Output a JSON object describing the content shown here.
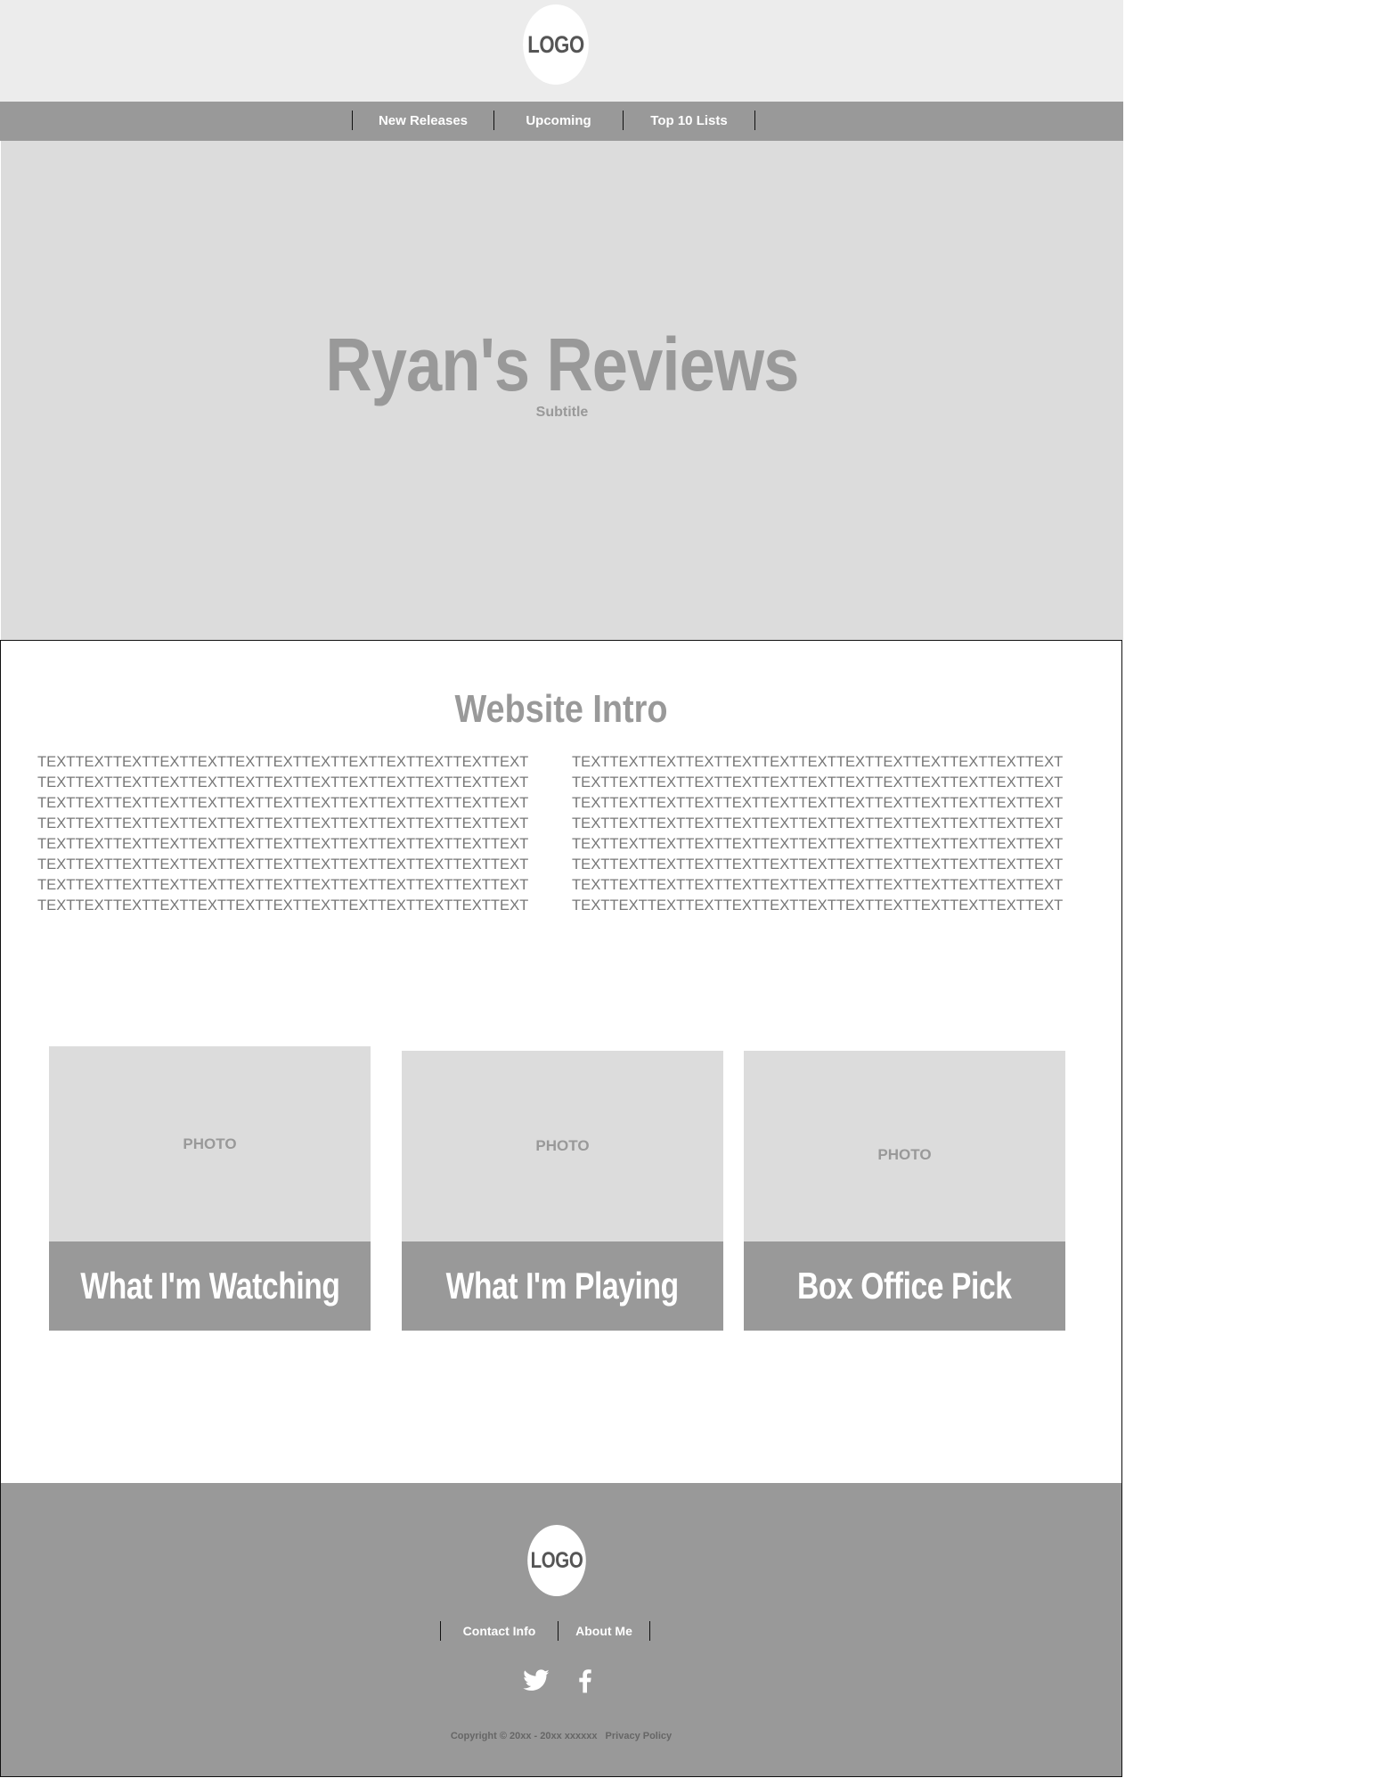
{
  "header": {
    "logo_text": "LOGO"
  },
  "nav": {
    "items": [
      {
        "label": "New Releases"
      },
      {
        "label": "Upcoming"
      },
      {
        "label": "Top 10 Lists"
      }
    ]
  },
  "hero": {
    "title": "Ryan's Reviews",
    "subtitle": "Subtitle"
  },
  "intro": {
    "title": "Website Intro",
    "columns": [
      {
        "text": "TEXTTEXTTEXTTEXTTEXTTEXTTEXTTEXTTEXTTEXTTEXTTEXTTEXTTEXTTEXTTEXTTEXTTEXTTEXTTEXTTEXTTEXTTEXTTEXTTEXTTEXTTEXTTEXTTEXTTEXTTEXTTEXTTEXTTEXTTEXTTEXTTEXTTEXTTEXTTEXTTEXTTEXTTEXTTEXTTEXTTEXTTEXTTEXTTEXTTEXTTEXTTEXTTEXTTEXTTEXTTEXTTEXTTEXTTEXTTEXTTEXTTEXTTEXTTEXTTEXTTEXTTEXTTEXTTEXTTEXTTEXTTEXTTEXTTEXTTEXTTEXTTEXTTEXTTEXTTEXTTEXTTEXTTEXTTEXTTEXTTEXTTEXTTEXTTEXTTEXTTEXTTEXTTEXTTEXTTEXTTEXTTEXTTEXTTEXTTEXTTEXTTEXTTEXTTEXTTEXTTEXTTEXT"
      },
      {
        "text": "TEXTTEXTTEXTTEXTTEXTTEXTTEXTTEXTTEXTTEXTTEXTTEXTTEXTTEXTTEXTTEXTTEXTTEXTTEXTTEXTTEXTTEXTTEXTTEXTTEXTTEXTTEXTTEXTTEXTTEXTTEXTTEXTTEXTTEXTTEXTTEXTTEXTTEXTTEXTTEXTTEXTTEXTTEXTTEXTTEXTTEXTTEXTTEXTTEXTTEXTTEXTTEXTTEXTTEXTTEXTTEXTTEXTTEXTTEXTTEXTTEXTTEXTTEXTTEXTTEXTTEXTTEXTTEXTTEXTTEXTTEXTTEXTTEXTTEXTTEXTTEXTTEXTTEXTTEXTTEXTTEXTTEXTTEXTTEXTTEXTTEXTTEXTTEXTTEXTTEXTTEXTTEXTTEXTTEXTTEXTTEXTTEXTTEXTTEXTTEXTTEXTTEXTTEXTTEXTTEXTTEXTTEXTTEXT"
      }
    ]
  },
  "cards": [
    {
      "photo_label": "PHOTO",
      "title": "What I'm Watching"
    },
    {
      "photo_label": "PHOTO",
      "title": "What I'm Playing"
    },
    {
      "photo_label": "PHOTO",
      "title": "Box Office Pick"
    }
  ],
  "footer": {
    "logo_text": "LOGO",
    "links": [
      {
        "label": "Contact Info"
      },
      {
        "label": "About Me"
      }
    ],
    "social": [
      {
        "icon": "twitter-icon"
      },
      {
        "icon": "facebook-icon"
      }
    ],
    "copyright": "Copyright © 20xx - 20xx xxxxxx",
    "privacy_label": "Privacy Policy"
  },
  "colors": {
    "header_bg": "#ececec",
    "nav_bg": "#999999",
    "hero_bg": "#dcdcdc",
    "accent_gray": "#999999",
    "white": "#ffffff"
  }
}
